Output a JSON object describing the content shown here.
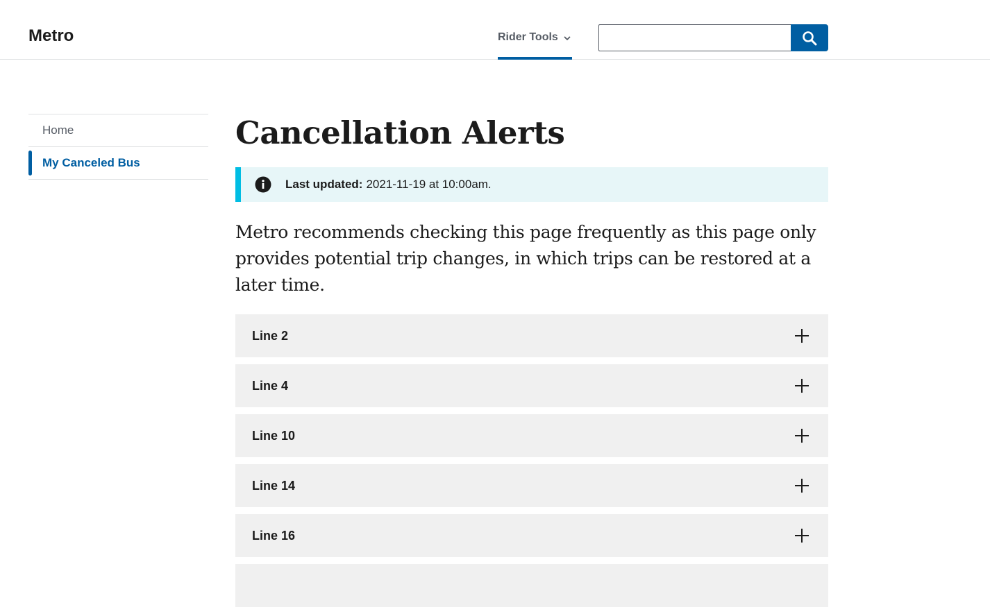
{
  "header": {
    "logo": "Metro",
    "nav_label": "Rider Tools",
    "search_placeholder": "",
    "search_value": ""
  },
  "sidenav": {
    "items": [
      {
        "label": "Home"
      },
      {
        "label": "My Canceled Bus"
      }
    ]
  },
  "main": {
    "title": "Cancellation Alerts",
    "alert": {
      "label": "Last updated:",
      "value": "2021-11-19 at 10:00am."
    },
    "intro": "Metro recommends checking this page frequently as this page only provides potential trip changes, in which trips can be restored at a later time.",
    "accordion": [
      {
        "label": "Line 2"
      },
      {
        "label": "Line 4"
      },
      {
        "label": "Line 10"
      },
      {
        "label": "Line 14"
      },
      {
        "label": "Line 16"
      },
      {
        "label": ""
      }
    ]
  },
  "colors": {
    "primary": "#005ea2",
    "alert_border": "#00bde3",
    "alert_bg": "#e7f6f8",
    "accordion_bg": "#f0f0f0"
  },
  "icons": [
    "chevron-down-icon",
    "search-icon",
    "info-icon",
    "plus-icon"
  ]
}
